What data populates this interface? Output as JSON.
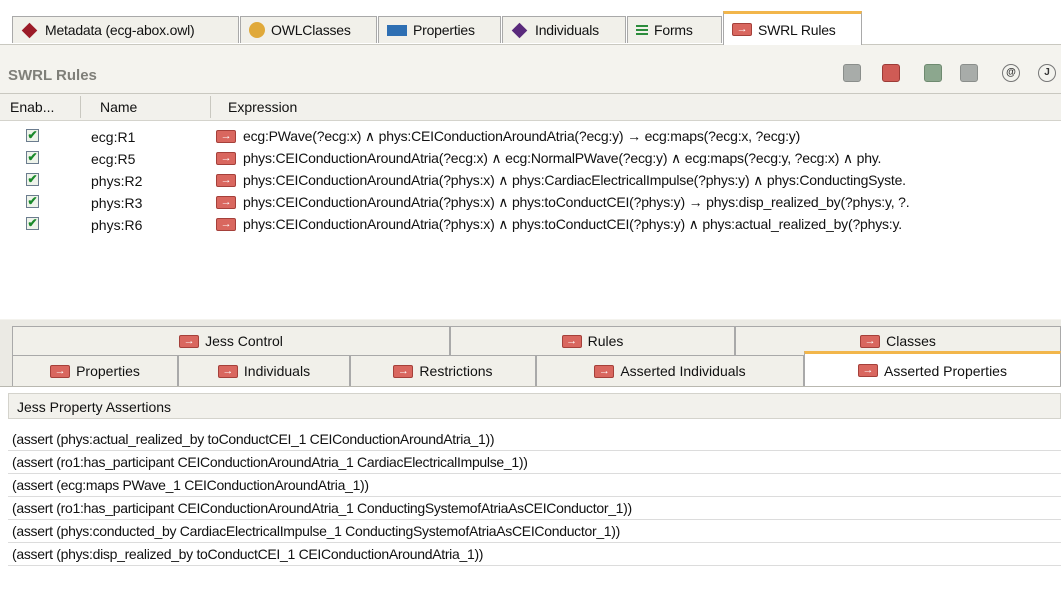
{
  "top_tabs": [
    {
      "label": "Metadata (ecg-abox.owl)",
      "icon": "diamond-red-icon"
    },
    {
      "label": "OWLClasses",
      "icon": "circle-orange-icon"
    },
    {
      "label": "Properties",
      "icon": "rect-blue-icon"
    },
    {
      "label": "Individuals",
      "icon": "diamond-purple-icon"
    },
    {
      "label": "Forms",
      "icon": "forms-icon"
    },
    {
      "label": "SWRL Rules",
      "icon": "rule-icon"
    }
  ],
  "swrl": {
    "title": "SWRL Rules",
    "toolbar_round_1": "@",
    "toolbar_round_2": "J"
  },
  "rules_table": {
    "headers": [
      "Enab...",
      "Name",
      "Expression"
    ],
    "rows": [
      {
        "enabled": true,
        "name": "ecg:R1",
        "expression": "ecg:PWave(?ecg:x)  ∧  phys:CEIConductionAroundAtria(?ecg:y) → ecg:maps(?ecg:x, ?ecg:y)"
      },
      {
        "enabled": true,
        "name": "ecg:R5",
        "expression": "phys:CEIConductionAroundAtria(?ecg:x)  ∧  ecg:NormalPWave(?ecg:y)  ∧  ecg:maps(?ecg:y, ?ecg:x)  ∧  phy."
      },
      {
        "enabled": true,
        "name": "phys:R2",
        "expression": "phys:CEIConductionAroundAtria(?phys:x)  ∧  phys:CardiacElectricalImpulse(?phys:y)  ∧  phys:ConductingSyste."
      },
      {
        "enabled": true,
        "name": "phys:R3",
        "expression": "phys:CEIConductionAroundAtria(?phys:x)  ∧  phys:toConductCEI(?phys:y) → phys:disp_realized_by(?phys:y, ?."
      },
      {
        "enabled": true,
        "name": "phys:R6",
        "expression": "phys:CEIConductionAroundAtria(?phys:x)  ∧  phys:toConductCEI(?phys:y)  ∧  phys:actual_realized_by(?phys:y."
      }
    ]
  },
  "lower_tabs": {
    "row1": [
      "Jess Control",
      "Rules",
      "Classes"
    ],
    "row2": [
      "Properties",
      "Individuals",
      "Restrictions",
      "Asserted Individuals",
      "Asserted Properties"
    ]
  },
  "assertions": {
    "title": "Jess Property Assertions",
    "rows": [
      "(assert (phys:actual_realized_by toConductCEI_1 CEIConductionAroundAtria_1))",
      "(assert (ro1:has_participant CEIConductionAroundAtria_1 CardiacElectricalImpulse_1))",
      "(assert (ecg:maps PWave_1 CEIConductionAroundAtria_1))",
      "(assert (ro1:has_participant CEIConductionAroundAtria_1 ConductingSystemofAtriaAsCEIConductor_1))",
      "(assert (phys:conducted_by CardiacElectricalImpulse_1 ConductingSystemofAtriaAsCEIConductor_1))",
      "(assert (phys:disp_realized_by toConductCEI_1 CEIConductionAroundAtria_1))"
    ]
  },
  "arrow_glyph": "→",
  "check_glyph": "✔"
}
